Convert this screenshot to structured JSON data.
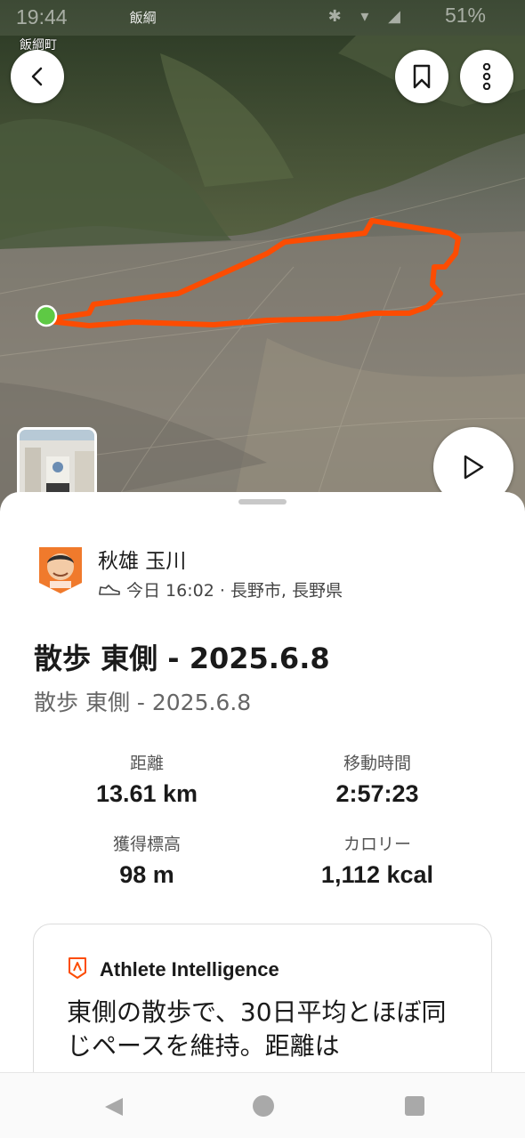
{
  "status_bar": {
    "time": "19:44",
    "notification_text": "飯綱",
    "battery": "51%"
  },
  "map": {
    "place_label": "飯綱町",
    "route_color": "#fc4c02",
    "start_marker_color": "#5ec944"
  },
  "athlete": {
    "name": "秋雄 玉川",
    "activity_icon": "shoe-icon",
    "meta": "今日 16:02 · 長野市, 長野県"
  },
  "activity": {
    "title": "散歩 東側 - 2025.6.8",
    "description": "散歩 東側 - 2025.6.8"
  },
  "stats": [
    {
      "label": "距離",
      "value": "13.61 km"
    },
    {
      "label": "移動時間",
      "value": "2:57:23"
    },
    {
      "label": "獲得標高",
      "value": "98 m"
    },
    {
      "label": "カロリー",
      "value": "1,112 kcal"
    }
  ],
  "athlete_intelligence": {
    "title": "Athlete Intelligence",
    "text": "東側の散歩で、30日平均とほぼ同じペースを維持。距離は"
  },
  "colors": {
    "accent": "#fc4c02"
  }
}
